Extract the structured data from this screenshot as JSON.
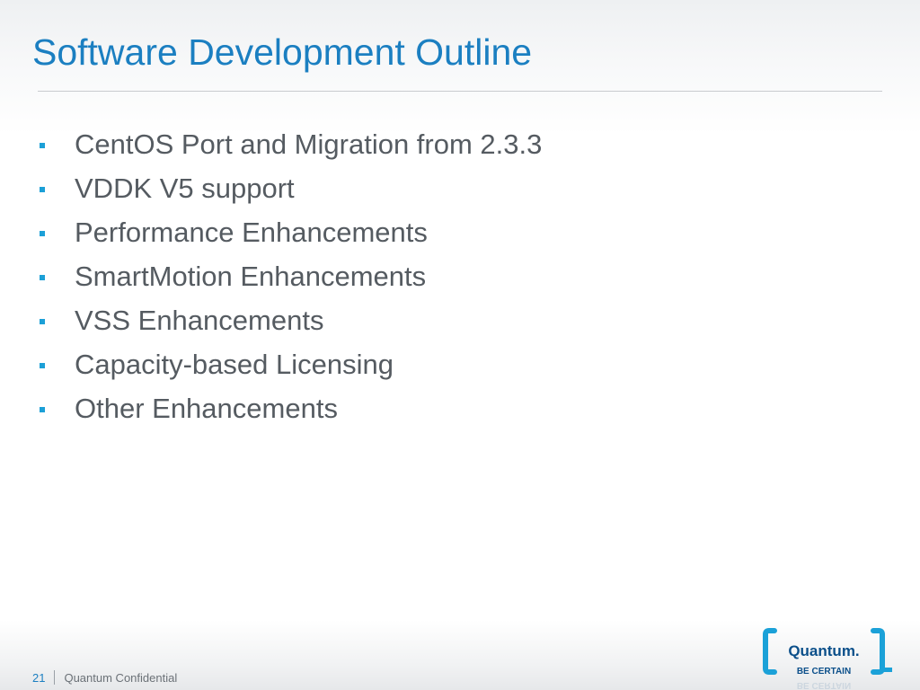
{
  "slide": {
    "title": "Software Development Outline",
    "bullets": [
      "CentOS Port and Migration from 2.3.3",
      "VDDK V5 support",
      "Performance Enhancements",
      "SmartMotion Enhancements",
      "VSS Enhancements",
      "Capacity-based Licensing",
      "Other Enhancements"
    ]
  },
  "footer": {
    "page_number": "21",
    "confidential": "Quantum Confidential"
  },
  "logo": {
    "brand": "Quantum.",
    "tagline": "BE CERTAIN"
  },
  "colors": {
    "title": "#1b7fc1",
    "bullet_marker": "#1ca0d7",
    "body_text": "#555b61",
    "logo_bracket": "#1ba1d8",
    "logo_text": "#0b4f8a"
  }
}
